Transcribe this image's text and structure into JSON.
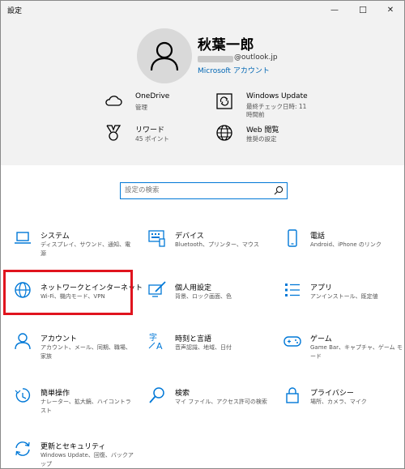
{
  "window": {
    "title": "設定",
    "minimize": "—",
    "maximize": "☐",
    "close": "✕"
  },
  "account": {
    "name": "秋葉一郎",
    "email_visible": "@outlook.jp",
    "account_link": "Microsoft アカウント"
  },
  "header_items": [
    {
      "title": "OneDrive",
      "subtitle": "管理",
      "icon": "cloud-icon"
    },
    {
      "title": "Windows Update",
      "subtitle": "最終チェック日時: 11 時間前",
      "icon": "refresh-icon"
    },
    {
      "title": "リワード",
      "subtitle": "45 ポイント",
      "icon": "medal-icon"
    },
    {
      "title": "Web 閲覧",
      "subtitle": "推奨の設定",
      "icon": "globe-icon"
    }
  ],
  "search": {
    "placeholder": "設定の検索"
  },
  "tiles": [
    {
      "label": "システム",
      "desc": "ディスプレイ、サウンド、通知、電源",
      "icon": "laptop-icon"
    },
    {
      "label": "デバイス",
      "desc": "Bluetooth、プリンター、マウス",
      "icon": "keyboard-icon"
    },
    {
      "label": "電話",
      "desc": "Android、iPhone のリンク",
      "icon": "phone-icon"
    },
    {
      "label": "ネットワークとインターネット",
      "desc": "Wi-Fi、機内モード、VPN",
      "icon": "globe-icon"
    },
    {
      "label": "個人用設定",
      "desc": "背景、ロック画面、色",
      "icon": "personalization-icon"
    },
    {
      "label": "アプリ",
      "desc": "アンインストール、既定値",
      "icon": "apps-list-icon"
    },
    {
      "label": "アカウント",
      "desc": "アカウント、メール、同期、職場、家族",
      "icon": "person-icon"
    },
    {
      "label": "時刻と言語",
      "desc": "音声認識、地域、日付",
      "icon": "time-language-icon"
    },
    {
      "label": "ゲーム",
      "desc": "Game Bar、キャプチャ、ゲーム モード",
      "icon": "gamepad-icon"
    },
    {
      "label": "簡単操作",
      "desc": "ナレーター、拡大鏡、ハイコントラスト",
      "icon": "ease-of-access-icon"
    },
    {
      "label": "検索",
      "desc": "マイ ファイル、アクセス許可の検索",
      "icon": "search-icon"
    },
    {
      "label": "プライバシー",
      "desc": "場所、カメラ、マイク",
      "icon": "lock-icon"
    },
    {
      "label": "更新とセキュリティ",
      "desc": "Windows Update、回復、バックアップ",
      "icon": "update-icon"
    }
  ],
  "colors": {
    "accent": "#0078d7",
    "highlight": "#e0141e",
    "header_bg": "#f2f2f2"
  }
}
